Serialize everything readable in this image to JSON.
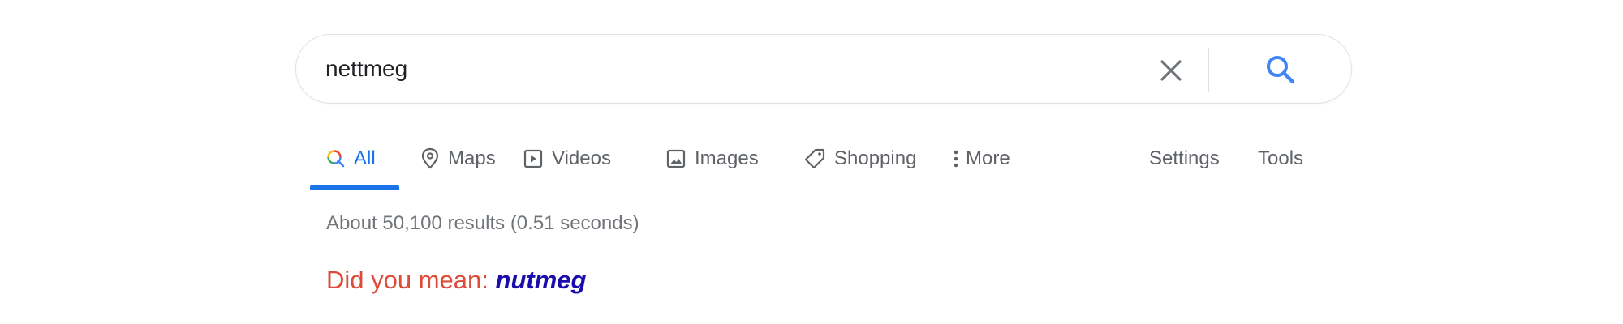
{
  "search": {
    "query": "nettmeg",
    "clear_icon": "close-icon",
    "search_icon": "search-icon"
  },
  "tabs": [
    {
      "label": "All",
      "icon": "search-icon",
      "active": true
    },
    {
      "label": "Maps",
      "icon": "map-pin-icon",
      "active": false
    },
    {
      "label": "Videos",
      "icon": "play-video-icon",
      "active": false
    },
    {
      "label": "Images",
      "icon": "image-icon",
      "active": false
    },
    {
      "label": "Shopping",
      "icon": "tag-icon",
      "active": false
    },
    {
      "label": "More",
      "icon": "more-vert-icon",
      "active": false
    }
  ],
  "tools": {
    "settings_label": "Settings",
    "tools_label": "Tools"
  },
  "results": {
    "stats": "About 50,100 results (0.51 seconds)"
  },
  "spelling": {
    "prefix": "Did you mean:",
    "suggestion": "nutmeg"
  },
  "colors": {
    "accent": "#1a73e8",
    "text_gray": "#5f6368",
    "dym_red": "#dd4b39",
    "link_blue": "#1a0dab"
  }
}
